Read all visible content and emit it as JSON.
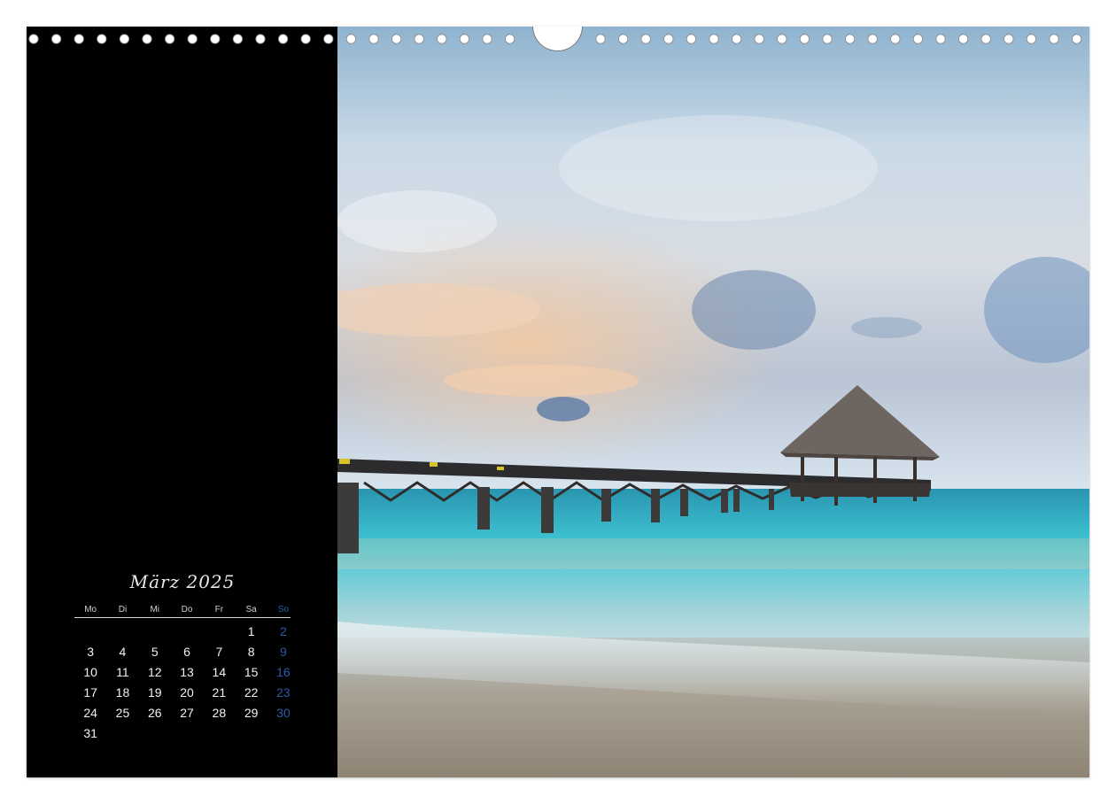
{
  "calendar": {
    "title": "März 2025",
    "weekdays": [
      "Mo",
      "Di",
      "Mi",
      "Do",
      "Fr",
      "Sa",
      "So"
    ],
    "weeks": [
      [
        "",
        "",
        "",
        "",
        "",
        "1",
        "2"
      ],
      [
        "3",
        "4",
        "5",
        "6",
        "7",
        "8",
        "9"
      ],
      [
        "10",
        "11",
        "12",
        "13",
        "14",
        "15",
        "16"
      ],
      [
        "17",
        "18",
        "19",
        "20",
        "21",
        "22",
        "23"
      ],
      [
        "24",
        "25",
        "26",
        "27",
        "28",
        "29",
        "30"
      ],
      [
        "31",
        "",
        "",
        "",
        "",
        "",
        ""
      ]
    ]
  },
  "photo": {
    "subject": "wooden-jetty-with-thatched-hut-over-turquoise-sea"
  },
  "colors": {
    "panel": "#000000",
    "sunday": "#2f58a8",
    "text": "#f2f2f2",
    "sea": "#3fc6d4"
  }
}
